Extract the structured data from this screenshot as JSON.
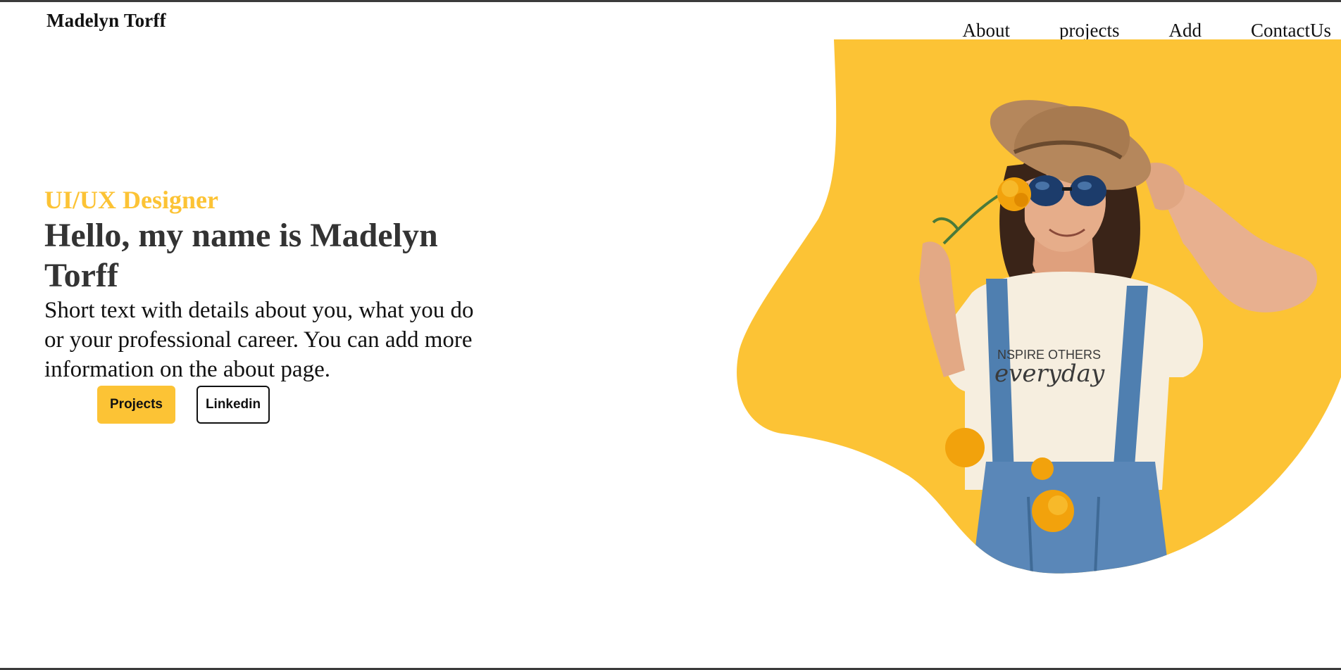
{
  "header": {
    "brand": "Madelyn Torff",
    "nav": [
      {
        "label": "About"
      },
      {
        "label": "projects"
      },
      {
        "label": "Add"
      },
      {
        "label": "ContactUs"
      }
    ]
  },
  "hero": {
    "role": "UI/UX Designer",
    "headline": "Hello, my name is Madelyn Torff",
    "intro": "Short text with details about you, what you do or your professional career. You can add more information on the about page.",
    "buttons": {
      "primary": "Projects",
      "secondary": "Linkedin"
    },
    "shirt_text_line1": "NSPIRE OTHERS",
    "shirt_text_line2": "everyday"
  },
  "colors": {
    "accent": "#fcc335",
    "headline": "#333333",
    "text": "#111111"
  }
}
